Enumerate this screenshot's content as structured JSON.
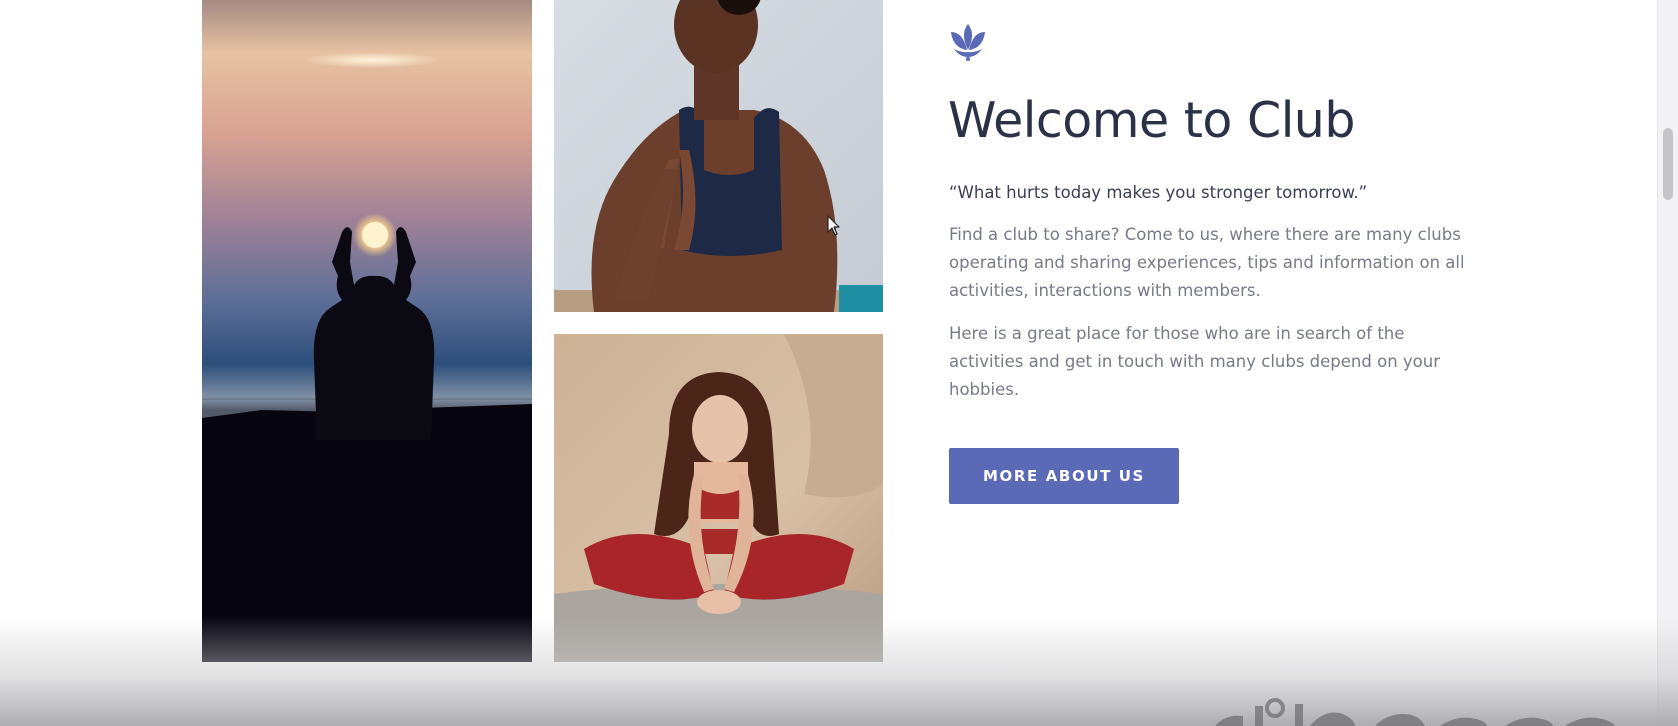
{
  "about": {
    "title": "Welcome to Club",
    "quote": "“What hurts today makes you stronger tomorrow.”",
    "paragraph_1": "Find a club to share? Come to us, where there are many clubs operating and sharing experiences, tips and information on all activities, interactions with members.",
    "paragraph_2": "Here is a great place for those who are in search of the activities and get in touch with many clubs depend on your hobbies.",
    "button_label": "MORE ABOUT US"
  },
  "icons": {
    "logo": "lotus-icon",
    "cursor": "mouse-pointer-icon"
  },
  "colors": {
    "accent": "#5a6ab7",
    "heading": "#2b3147",
    "body_text": "#777b88"
  }
}
